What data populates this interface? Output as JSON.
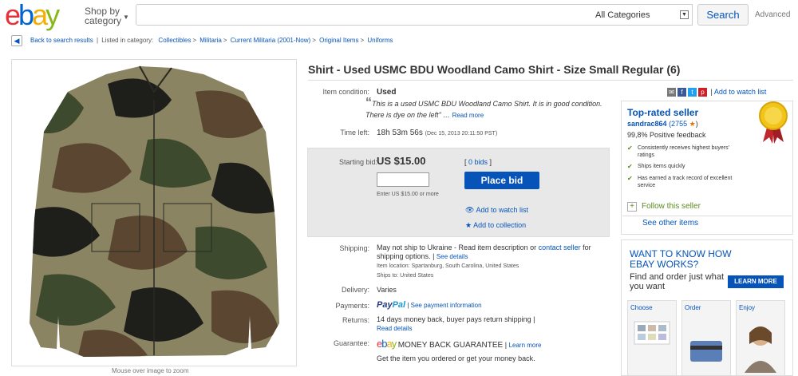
{
  "header": {
    "logo": [
      "e",
      "b",
      "a",
      "y"
    ],
    "shop_by": "Shop by category",
    "search_placeholder": "",
    "category_select": "All Categories",
    "search_button": "Search",
    "advanced": "Advanced"
  },
  "breadcrumb": {
    "back": "Back to search results",
    "listed_in": "Listed in category:",
    "items": [
      "Collectibles",
      "Militaria",
      "Current Militaria (2001-Now)",
      "Original Items",
      "Uniforms"
    ]
  },
  "image": {
    "hint": "Mouse over image to zoom"
  },
  "item": {
    "title": "Shirt - Used USMC BDU Woodland Camo Shirt - Size Small Regular (6)",
    "condition_label": "Item condition:",
    "condition_value": "Used",
    "description": "This is a used USMC BDU Woodland Camo Shirt. It is in good condition. There is dye on the left",
    "read_more": "Read more",
    "time_left_label": "Time left:",
    "time_left_value": "18h 53m 56s",
    "time_left_date": "(Dec 15, 2013  20:11:50 PST)",
    "starting_bid_label": "Starting bid:",
    "starting_bid_value": "US $15.00",
    "bids": "0 bids",
    "place_bid": "Place bid",
    "enter_hint": "Enter US $15.00 or more",
    "add_watch": "Add to watch list",
    "add_collection": "Add to collection",
    "shipping_label": "Shipping:",
    "shipping_text": "May not ship to Ukraine - Read item description or",
    "contact_seller": "contact seller",
    "shipping_text2": "for shipping options.",
    "see_details": "See details",
    "item_location": "Item location: Spartanburg, South Carolina, United States",
    "ships_to": "Ships to: United States",
    "delivery_label": "Delivery:",
    "delivery_value": "Varies",
    "payments_label": "Payments:",
    "paypal_1": "Pay",
    "paypal_2": "Pal",
    "see_payment": "See payment information",
    "returns_label": "Returns:",
    "returns_value": "14 days money back, buyer pays return shipping",
    "read_details": "Read details",
    "guarantee_label": "Guarantee:",
    "money_back": "MONEY BACK GUARANTEE",
    "learn_more": "Learn more",
    "guarantee_text": "Get the item you ordered or get your money back."
  },
  "share": {
    "add_watch": "Add to watch list"
  },
  "seller": {
    "top_rated": "Top-rated seller",
    "name": "sandrac864",
    "score": "(2755",
    "feedback": "99,8% Positive feedback",
    "bullets": [
      "Consistently receives highest buyers' ratings",
      "Ships items quickly",
      "Has earned a track record of excellent service"
    ],
    "follow": "Follow this seller",
    "see_other": "See other items"
  },
  "ad": {
    "headline": "WANT TO KNOW HOW EBAY WORKS?",
    "sub": "Find and order just what you want",
    "learn_more": "LEARN MORE",
    "tiles": [
      "Choose",
      "Order",
      "Enjoy"
    ]
  },
  "colors": {
    "link": "#0654ba",
    "green": "#5c8a1f"
  }
}
